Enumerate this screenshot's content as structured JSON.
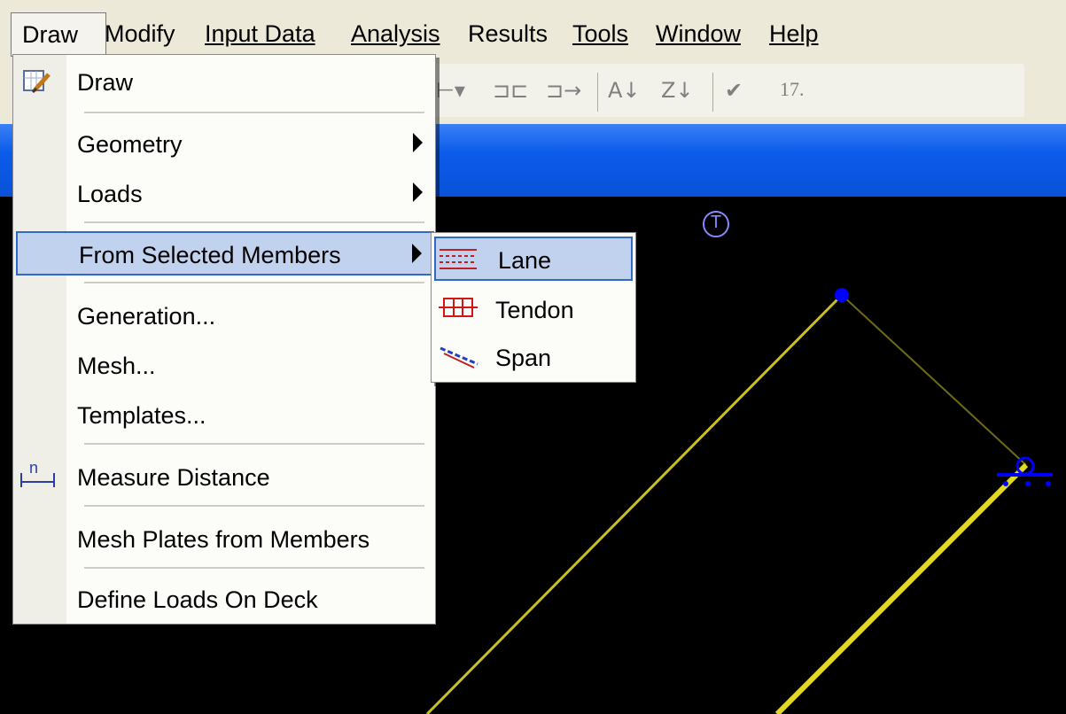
{
  "menubar": {
    "items": [
      "Draw",
      "Modify",
      "Input Data",
      "Analysis",
      "Results",
      "Tools",
      "Window",
      "Help"
    ]
  },
  "toolbar": {
    "number": "17."
  },
  "draw_menu": {
    "items": {
      "draw": "Draw",
      "geometry": "Geometry",
      "loads": "Loads",
      "from_selected": "From Selected Members",
      "generation": "Generation...",
      "mesh": "Mesh...",
      "templates": "Templates...",
      "measure": "Measure Distance",
      "mesh_plates": "Mesh Plates from Members",
      "define_loads": "Define Loads On Deck"
    },
    "measure_icon_text": "n"
  },
  "submenu": {
    "items": [
      "Lane",
      "Tendon",
      "Span"
    ]
  },
  "canvas": {
    "axis_symbol": "T"
  },
  "colors": {
    "menu_highlight": "#c1d2ee",
    "highlight_border": "#316ac5",
    "title_blue": "#0a52d8",
    "member_yellow": "#c8c020",
    "node_blue": "#0000ff"
  }
}
